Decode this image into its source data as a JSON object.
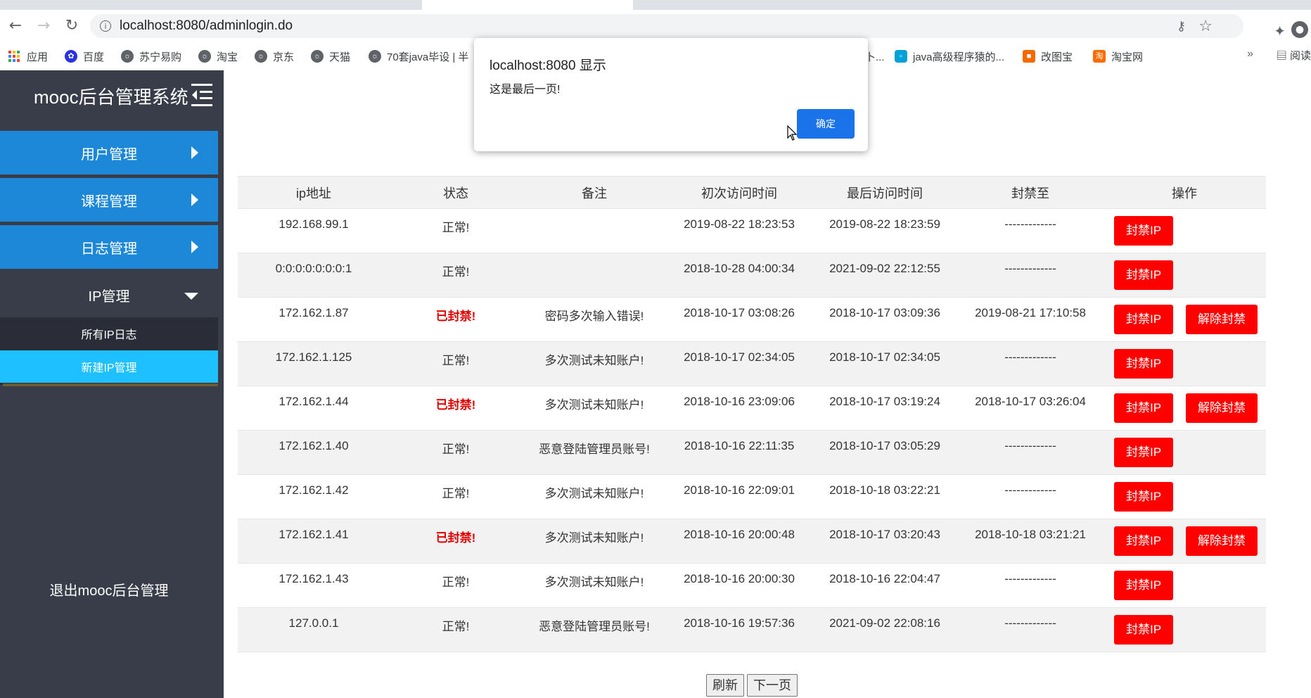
{
  "browser": {
    "url": "localhost:8080/adminlogin.do",
    "bookmarks": [
      {
        "label": "应用",
        "icon": "apps-icon"
      },
      {
        "label": "百度",
        "icon": "baidu-icon"
      },
      {
        "label": "苏宁易购",
        "icon": "globe-icon"
      },
      {
        "label": "淘宝",
        "icon": "globe-icon"
      },
      {
        "label": "京东",
        "icon": "globe-icon"
      },
      {
        "label": "天猫",
        "icon": "globe-icon"
      },
      {
        "label": "70套java毕设 | 半",
        "icon": "globe-icon"
      },
      {
        "label": "卜...",
        "icon": "none"
      },
      {
        "label": "java高级程序猿的...",
        "icon": "bilibili-icon"
      },
      {
        "label": "改图宝",
        "icon": "gaitubao-icon"
      },
      {
        "label": "淘宝网",
        "icon": "taobao-icon"
      }
    ],
    "bookmarks_more": "»",
    "reading_list": "阅读",
    "colors": {
      "accent": "#1a73e8"
    }
  },
  "sidebar": {
    "title": "mooc后台管理系统",
    "menu": [
      {
        "label": "用户管理"
      },
      {
        "label": "课程管理"
      },
      {
        "label": "日志管理"
      },
      {
        "label": "IP管理"
      }
    ],
    "submenu": [
      {
        "label": "所有IP日志"
      },
      {
        "label": "新建IP管理"
      }
    ],
    "logout": "退出mooc后台管理",
    "colors": {
      "menu": "#1e88d8",
      "active_sub": "#1ec0ff",
      "bg": "#393d49"
    }
  },
  "table": {
    "headers": [
      "ip地址",
      "状态",
      "备注",
      "初次访问时间",
      "最后访问时间",
      "封禁至",
      "操作"
    ],
    "ban_label": "封禁IP",
    "unban_label": "解除封禁",
    "rows": [
      {
        "ip": "192.168.99.1",
        "status": "正常!",
        "banned": false,
        "note": "",
        "first": "2019-08-22 18:23:53",
        "last": "2019-08-22 18:23:59",
        "until": "-------------"
      },
      {
        "ip": "0:0:0:0:0:0:0:1",
        "status": "正常!",
        "banned": false,
        "note": "",
        "first": "2018-10-28 04:00:34",
        "last": "2021-09-02 22:12:55",
        "until": "-------------"
      },
      {
        "ip": "172.162.1.87",
        "status": "已封禁!",
        "banned": true,
        "note": "密码多次输入错误!",
        "first": "2018-10-17 03:08:26",
        "last": "2018-10-17 03:09:36",
        "until": "2019-08-21 17:10:58"
      },
      {
        "ip": "172.162.1.125",
        "status": "正常!",
        "banned": false,
        "note": "多次测试未知账户!",
        "first": "2018-10-17 02:34:05",
        "last": "2018-10-17 02:34:05",
        "until": "-------------"
      },
      {
        "ip": "172.162.1.44",
        "status": "已封禁!",
        "banned": true,
        "note": "多次测试未知账户!",
        "first": "2018-10-16 23:09:06",
        "last": "2018-10-17 03:19:24",
        "until": "2018-10-17 03:26:04"
      },
      {
        "ip": "172.162.1.40",
        "status": "正常!",
        "banned": false,
        "note": "恶意登陆管理员账号!",
        "first": "2018-10-16 22:11:35",
        "last": "2018-10-17 03:05:29",
        "until": "-------------"
      },
      {
        "ip": "172.162.1.42",
        "status": "正常!",
        "banned": false,
        "note": "多次测试未知账户!",
        "first": "2018-10-16 22:09:01",
        "last": "2018-10-18 03:22:21",
        "until": "-------------"
      },
      {
        "ip": "172.162.1.41",
        "status": "已封禁!",
        "banned": true,
        "note": "多次测试未知账户!",
        "first": "2018-10-16 20:00:48",
        "last": "2018-10-17 03:20:43",
        "until": "2018-10-18 03:21:21"
      },
      {
        "ip": "172.162.1.43",
        "status": "正常!",
        "banned": false,
        "note": "多次测试未知账户!",
        "first": "2018-10-16 20:00:30",
        "last": "2018-10-16 22:04:47",
        "until": "-------------"
      },
      {
        "ip": "127.0.0.1",
        "status": "正常!",
        "banned": false,
        "note": "恶意登陆管理员账号!",
        "first": "2018-10-16 19:57:36",
        "last": "2021-09-02 22:08:16",
        "until": "-------------"
      }
    ],
    "colors": {
      "button": "#ff0000",
      "banned_text": "#e00000"
    }
  },
  "pager": {
    "refresh": "刷新",
    "next": "下一页"
  },
  "alert": {
    "title": "localhost:8080 显示",
    "message": "这是最后一页!",
    "ok": "确定"
  }
}
